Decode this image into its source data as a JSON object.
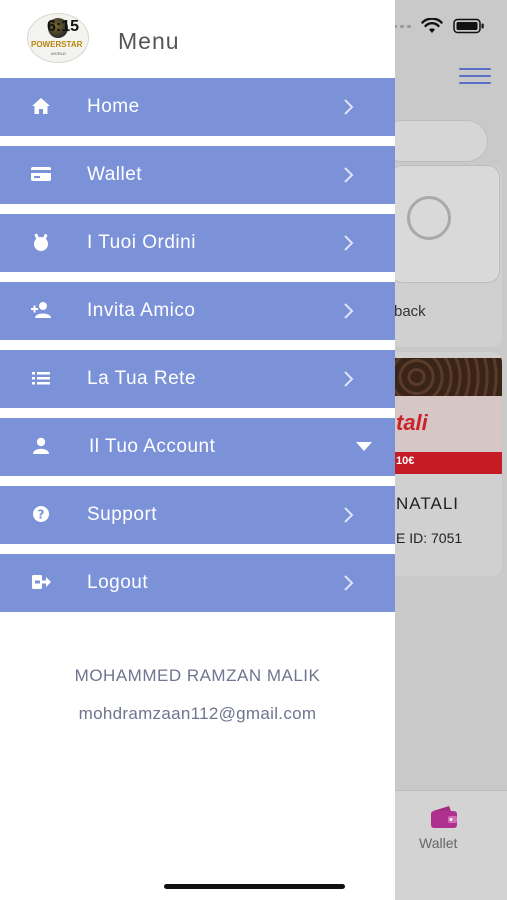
{
  "status_bar": {
    "time": "6:15"
  },
  "drawer": {
    "logo": {
      "text": "POWERSTAR",
      "sub": "WORLD"
    },
    "title": "Menu",
    "items": [
      {
        "label": "Home",
        "icon": "home-icon",
        "indicator": "chevron-right"
      },
      {
        "label": "Wallet",
        "icon": "credit-card-icon",
        "indicator": "chevron-right"
      },
      {
        "label": "I Tuoi Ordini",
        "icon": "orders-icon",
        "indicator": "chevron-right"
      },
      {
        "label": "Invita Amico",
        "icon": "add-user-icon",
        "indicator": "chevron-right"
      },
      {
        "label": "La Tua Rete",
        "icon": "list-icon",
        "indicator": "chevron-right"
      },
      {
        "label": "Il Tuo Account",
        "icon": "user-icon",
        "indicator": "caret-down"
      },
      {
        "label": "Support",
        "icon": "question-circle-icon",
        "indicator": "chevron-right"
      },
      {
        "label": "Logout",
        "icon": "logout-icon",
        "indicator": "chevron-right"
      }
    ],
    "user": {
      "name": "MOHAMMED RAMZAN MALIK",
      "email": "mohdramzaan112@gmail.com"
    }
  },
  "background": {
    "card1_text": "back",
    "card2_banner": "tali",
    "card2_price": "10€",
    "card2_title": "NATALI",
    "card2_id": "E ID: 7051",
    "tab_wallet_label": "Wallet"
  },
  "colors": {
    "menu_item_bg": "#7b91d8",
    "menu_text": "#ffffff",
    "footer_text": "#6f7490",
    "accent_purple": "#b0308f",
    "hamburger": "#5b6fc7"
  }
}
